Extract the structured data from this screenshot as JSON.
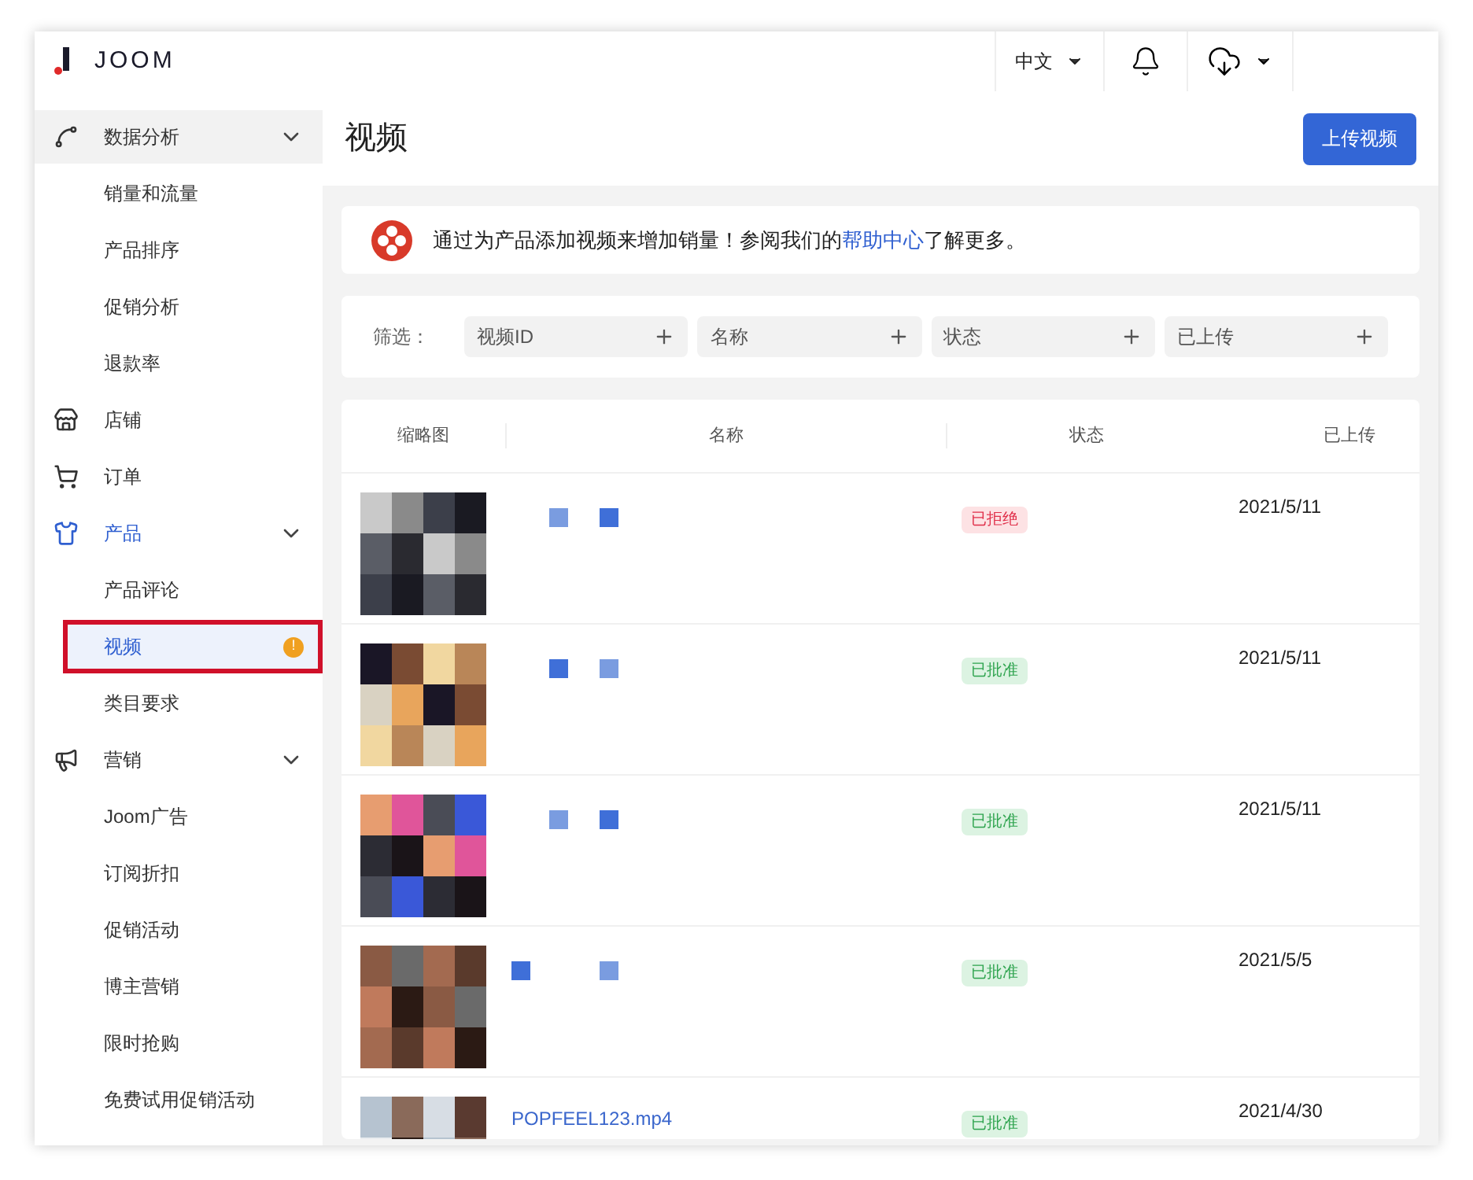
{
  "header": {
    "logo": "JOOM",
    "language": "中文"
  },
  "sidebar": {
    "items": [
      {
        "label": "数据分析",
        "expanded": true,
        "active": false,
        "children": [
          {
            "label": "销量和流量",
            "selected": false
          },
          {
            "label": "产品排序",
            "selected": false
          },
          {
            "label": "促销分析",
            "selected": false
          },
          {
            "label": "退款率",
            "selected": false
          }
        ]
      },
      {
        "label": "店铺",
        "active": false
      },
      {
        "label": "订单",
        "active": false
      },
      {
        "label": "产品",
        "expanded": true,
        "active": true,
        "children": [
          {
            "label": "产品评论",
            "selected": false
          },
          {
            "label": "视频",
            "selected": true,
            "highlighted": true,
            "badge": "!"
          },
          {
            "label": "类目要求",
            "selected": false
          }
        ]
      },
      {
        "label": "营销",
        "expanded": true,
        "active": false,
        "children": [
          {
            "label": "Joom广告",
            "selected": false
          },
          {
            "label": "订阅折扣",
            "selected": false
          },
          {
            "label": "促销活动",
            "selected": false
          },
          {
            "label": "博主营销",
            "selected": false
          },
          {
            "label": "限时抢购",
            "selected": false
          },
          {
            "label": "免费试用促销活动",
            "selected": false
          }
        ]
      }
    ]
  },
  "page": {
    "title": "视频",
    "upload_button": "上传视频"
  },
  "notice": {
    "before": "通过为产品添加视频来增加销量！参阅我们的",
    "link": "帮助中心",
    "after": "了解更多。"
  },
  "filters": {
    "label": "筛选：",
    "fields": [
      "视频ID",
      "名称",
      "状态",
      "已上传"
    ]
  },
  "table": {
    "columns": [
      "缩略图",
      "名称",
      "状态",
      "已上传"
    ],
    "rows": [
      {
        "status": {
          "text": "已拒绝",
          "kind": "rejected"
        },
        "uploaded": "2021/5/11"
      },
      {
        "status": {
          "text": "已批准",
          "kind": "approved"
        },
        "uploaded": "2021/5/11"
      },
      {
        "status": {
          "text": "已批准",
          "kind": "approved"
        },
        "uploaded": "2021/5/11"
      },
      {
        "status": {
          "text": "已批准",
          "kind": "approved"
        },
        "uploaded": "2021/5/5"
      },
      {
        "name": "POPFEEL123.mp4",
        "status": {
          "text": "已批准",
          "kind": "approved"
        },
        "uploaded": "2021/4/30"
      }
    ]
  }
}
